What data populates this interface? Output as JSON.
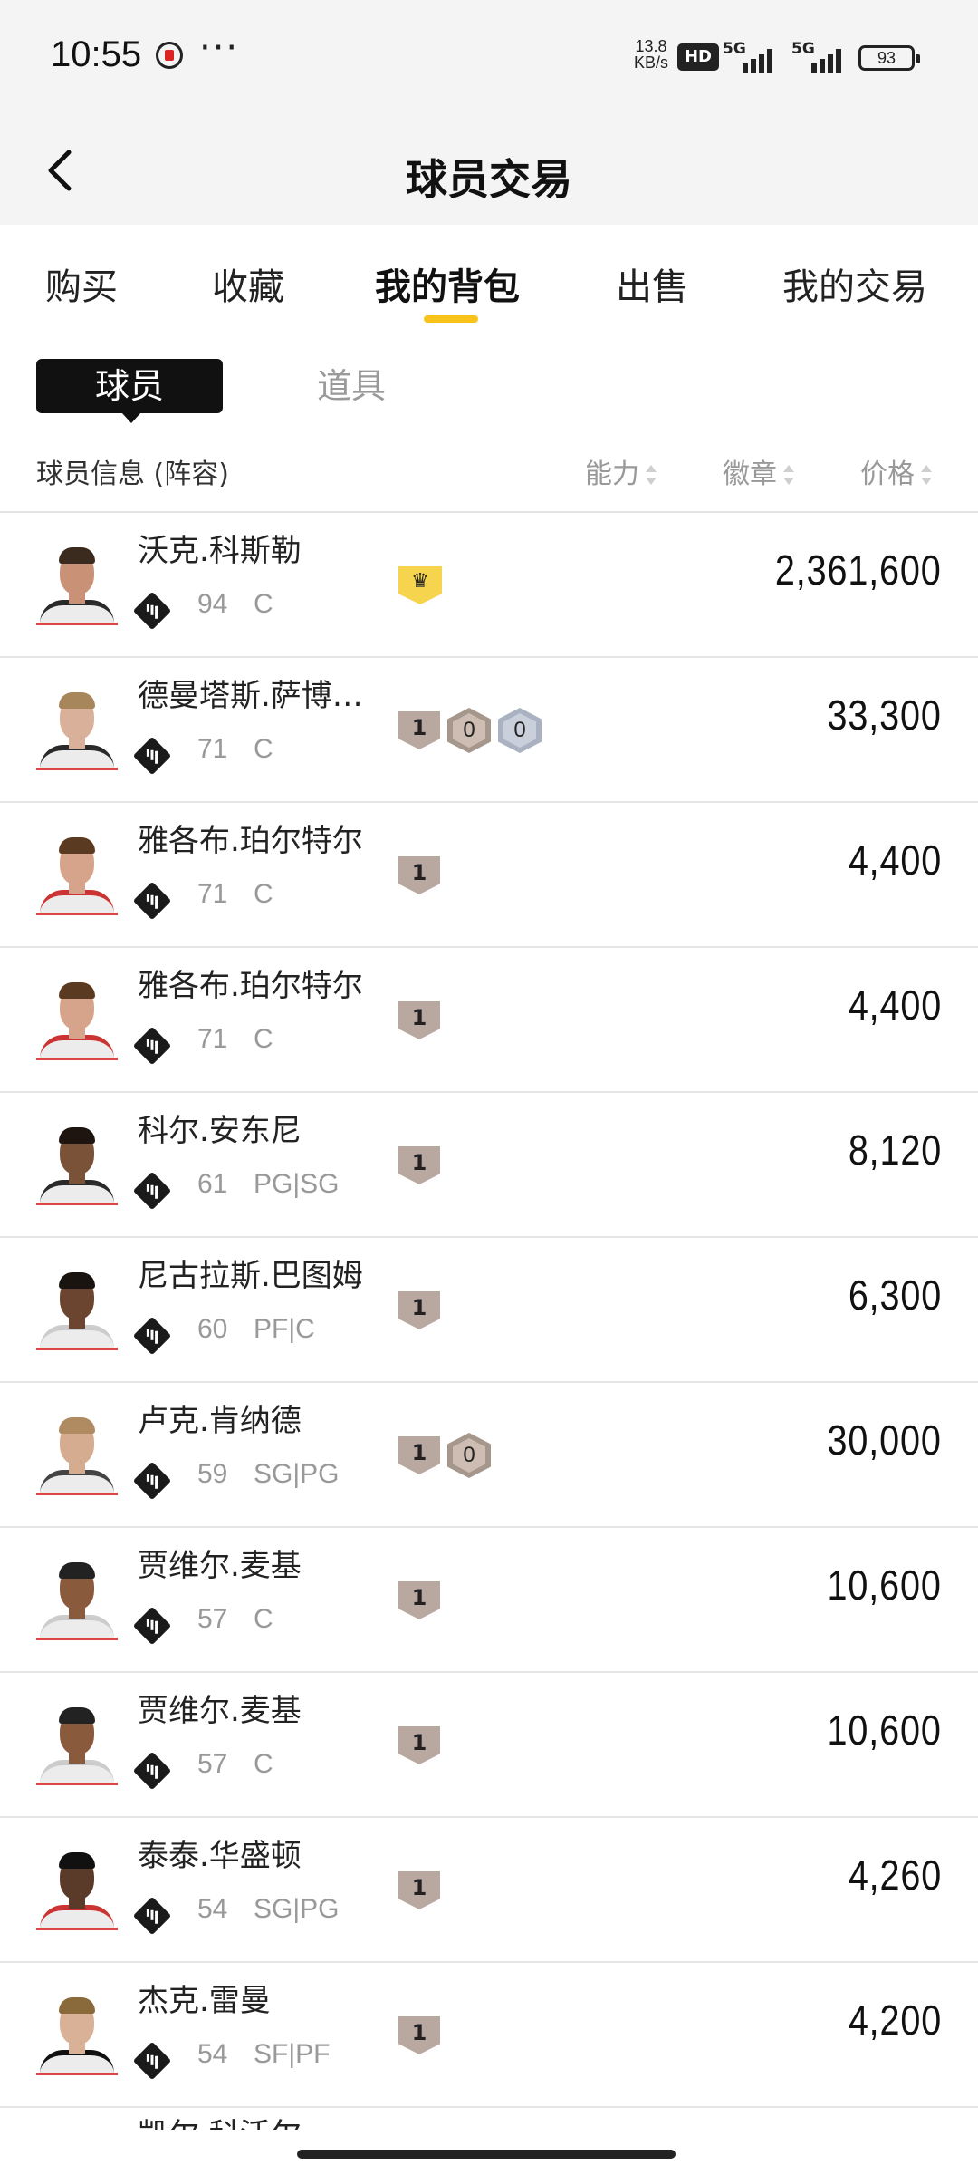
{
  "status_bar": {
    "time": "10:55",
    "speed_value": "13.8",
    "speed_unit": "KB/s",
    "hd_label": "HD",
    "signal1_label": "5G",
    "signal2_label": "5G",
    "battery": "93"
  },
  "header": {
    "back_icon": "chevron-left-icon",
    "title": "球员交易"
  },
  "tabs": [
    {
      "label": "购买",
      "active": false
    },
    {
      "label": "收藏",
      "active": false
    },
    {
      "label": "我的背包",
      "active": true
    },
    {
      "label": "出售",
      "active": false
    },
    {
      "label": "我的交易",
      "active": false
    }
  ],
  "segments": {
    "active": "球员",
    "other": "道具"
  },
  "columns": {
    "info": "球员信息 (阵容)",
    "ability": "能力",
    "badge": "徽章",
    "price": "价格"
  },
  "colors": {
    "accent": "#f7c31a",
    "crown_badge": "#f6d44d",
    "bronze_badge": "#b9a89f",
    "silver_badge": "#aab1c0"
  },
  "players": [
    {
      "name": "沃克.科斯勒",
      "ovr": "94",
      "pos": "C",
      "price": "2,361,600",
      "badges": [
        {
          "type": "crown",
          "text": "♛"
        }
      ]
    },
    {
      "name": "德曼塔斯.萨博…",
      "ovr": "71",
      "pos": "C",
      "price": "33,300",
      "badges": [
        {
          "type": "shield",
          "text": "1"
        },
        {
          "type": "hex-bronze",
          "text": "0"
        },
        {
          "type": "hex-silver",
          "text": "0"
        }
      ]
    },
    {
      "name": "雅各布.珀尔特尔",
      "ovr": "71",
      "pos": "C",
      "price": "4,400",
      "badges": [
        {
          "type": "shield",
          "text": "1"
        }
      ]
    },
    {
      "name": "雅各布.珀尔特尔",
      "ovr": "71",
      "pos": "C",
      "price": "4,400",
      "badges": [
        {
          "type": "shield",
          "text": "1"
        }
      ]
    },
    {
      "name": "科尔.安东尼",
      "ovr": "61",
      "pos": "PG|SG",
      "price": "8,120",
      "badges": [
        {
          "type": "shield",
          "text": "1"
        }
      ]
    },
    {
      "name": "尼古拉斯.巴图姆",
      "ovr": "60",
      "pos": "PF|C",
      "price": "6,300",
      "badges": [
        {
          "type": "shield",
          "text": "1"
        }
      ]
    },
    {
      "name": "卢克.肯纳德",
      "ovr": "59",
      "pos": "SG|PG",
      "price": "30,000",
      "badges": [
        {
          "type": "shield",
          "text": "1"
        },
        {
          "type": "hex-bronze",
          "text": "0"
        }
      ]
    },
    {
      "name": "贾维尔.麦基",
      "ovr": "57",
      "pos": "C",
      "price": "10,600",
      "badges": [
        {
          "type": "shield",
          "text": "1"
        }
      ]
    },
    {
      "name": "贾维尔.麦基",
      "ovr": "57",
      "pos": "C",
      "price": "10,600",
      "badges": [
        {
          "type": "shield",
          "text": "1"
        }
      ]
    },
    {
      "name": "泰泰.华盛顿",
      "ovr": "54",
      "pos": "SG|PG",
      "price": "4,260",
      "badges": [
        {
          "type": "shield",
          "text": "1"
        }
      ]
    },
    {
      "name": "杰克.雷曼",
      "ovr": "54",
      "pos": "SF|PF",
      "price": "4,200",
      "badges": [
        {
          "type": "shield",
          "text": "1"
        }
      ]
    }
  ],
  "partial_next": "凯尔.科沃尔"
}
